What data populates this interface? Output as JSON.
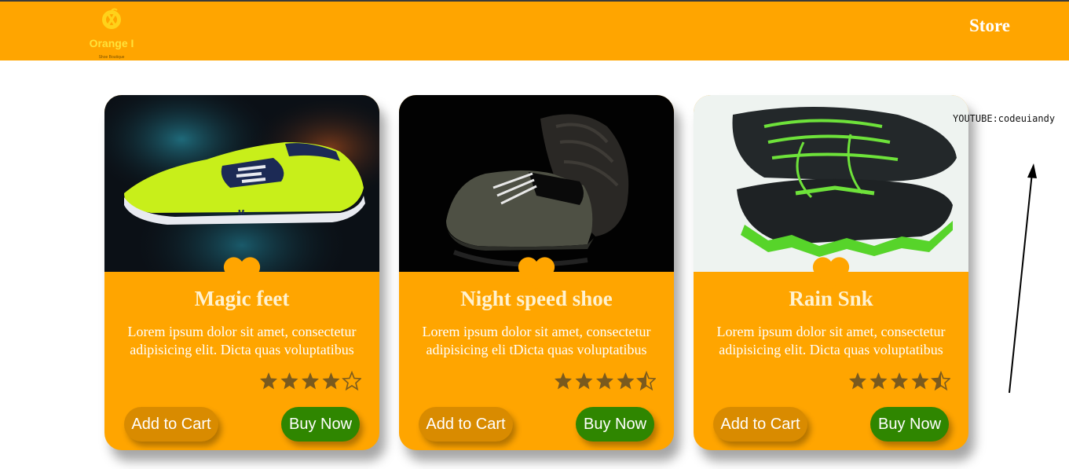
{
  "header": {
    "brand": "Orange I",
    "tagline": "Shoe Boutique",
    "logo_icon": "orange-fruit-icon",
    "nav_store": "Store",
    "background": "#ffa500"
  },
  "products": [
    {
      "title": "Magic feet",
      "description": "Lorem ipsum dolor sit amet, consectetur adipisicing elit. Dicta quas voluptatibus",
      "rating": 4,
      "rating_max": 5,
      "image": "neon yellow running shoe on dark background",
      "add_to_cart_label": "Add to Cart",
      "buy_now_label": "Buy Now"
    },
    {
      "title": "Night speed shoe",
      "description": "Lorem ipsum dolor sit amet, consectetur adipisicing eli tDicta quas voluptatibus",
      "rating": 4.5,
      "rating_max": 5,
      "image": "dark grey sneakers on black background",
      "add_to_cart_label": "Add to Cart",
      "buy_now_label": "Buy Now"
    },
    {
      "title": "Rain Snk",
      "description": "Lorem ipsum dolor sit amet, consectetur adipisicing elit. Dicta quas voluptatibus",
      "rating": 4.5,
      "rating_max": 5,
      "image": "black and green trail shoes on white background",
      "add_to_cart_label": "Add to Cart",
      "buy_now_label": "Buy Now"
    }
  ],
  "overlay": {
    "watermark": "YOUTUBE:codeuiandy"
  },
  "colors": {
    "accent": "#ffa500",
    "heart": "#ffa500",
    "star": "#7a5a1e",
    "cart_button": "#d98b00",
    "buy_button": "#2f8600"
  }
}
